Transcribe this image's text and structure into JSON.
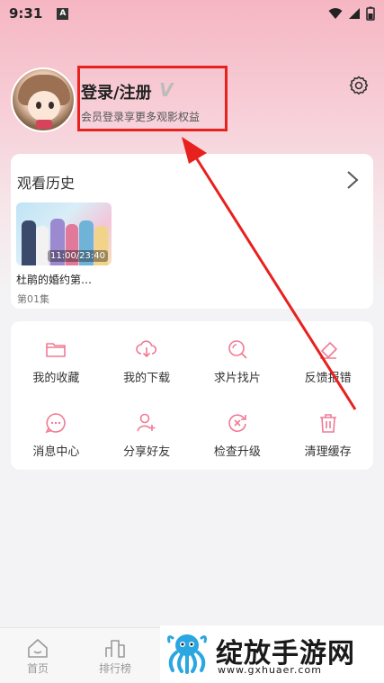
{
  "status_bar": {
    "time": "9:31",
    "notification_icon": "A"
  },
  "profile": {
    "login_label": "登录/注册",
    "vip_mark": "V",
    "subtitle": "会员登录享更多观影权益"
  },
  "history": {
    "title": "观看历史",
    "items": [
      {
        "name": "杜鹃的婚约第…",
        "episode": "第01集",
        "progress": "11:00/23:40"
      }
    ]
  },
  "menu": [
    {
      "label": "我的收藏",
      "icon": "folder-icon"
    },
    {
      "label": "我的下载",
      "icon": "cloud-download-icon"
    },
    {
      "label": "求片找片",
      "icon": "search-icon"
    },
    {
      "label": "反馈报错",
      "icon": "eraser-icon"
    },
    {
      "label": "消息中心",
      "icon": "message-icon"
    },
    {
      "label": "分享好友",
      "icon": "add-user-icon"
    },
    {
      "label": "检查升级",
      "icon": "update-icon"
    },
    {
      "label": "清理缓存",
      "icon": "trash-icon"
    }
  ],
  "bottom_nav": [
    {
      "label": "首页",
      "icon": "home-icon"
    },
    {
      "label": "排行榜",
      "icon": "ranking-icon"
    }
  ],
  "watermark": {
    "title": "绽放手游网",
    "url": "www.gxhuaer.com"
  },
  "colors": {
    "accent": "#f07a94",
    "annotation": "#e8201e"
  }
}
